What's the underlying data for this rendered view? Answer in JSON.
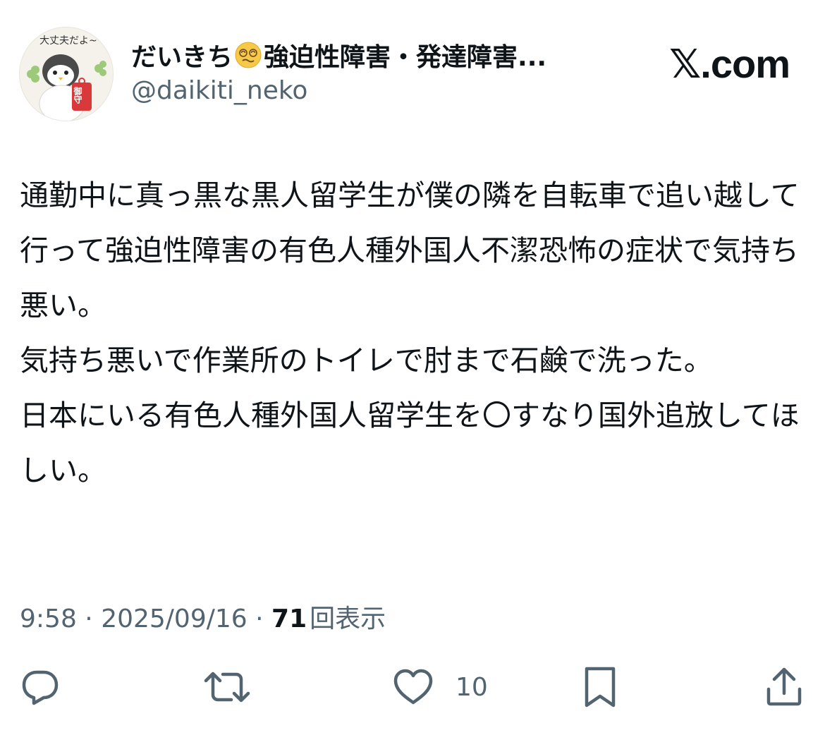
{
  "author": {
    "display_name": "だいきち",
    "name_suffix": "強迫性障害・発達障害...",
    "name_emoji": "dizzy-face-emoji",
    "handle": "@daikiti_neko",
    "avatar": {
      "icon": "penguin-omamori-avatar",
      "caption": "大丈夫だよ~",
      "charm_text": "御守"
    }
  },
  "brand": {
    "mark": "𝕏",
    "label": ".com"
  },
  "post": {
    "text": "通勤中に真っ黒な黒人留学生が僕の隣を自転車で追い越して行って強迫性障害の有色人種外国人不潔恐怖の症状で気持ち悪い。\n気持ち悪いで作業所のトイレで肘まで石鹸で洗った。\n日本にいる有色人種外国人留学生を〇すなり国外追放してほしい。",
    "time": "9:58",
    "date": "2025/09/16",
    "separator": " · ",
    "views": "71",
    "views_label": "回表示"
  },
  "actions": {
    "reply_icon": "reply-icon",
    "repost_icon": "repost-icon",
    "like_icon": "heart-icon",
    "like_count": "10",
    "bookmark_icon": "bookmark-icon",
    "share_icon": "share-icon"
  },
  "colors": {
    "text": "#0f1419",
    "secondary": "#536471",
    "background": "#ffffff"
  }
}
